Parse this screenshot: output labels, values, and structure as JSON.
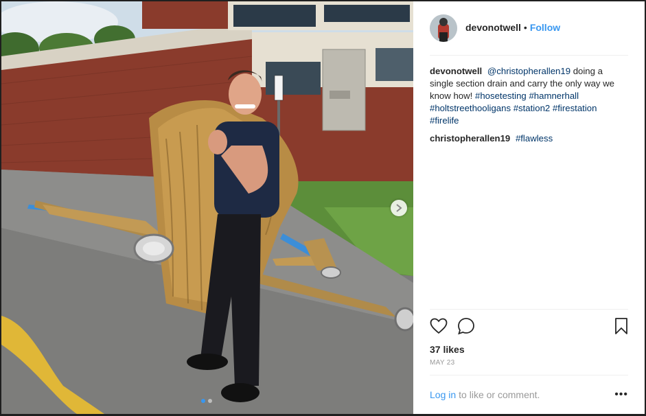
{
  "post": {
    "author": "devonotwell",
    "follow_label": "Follow",
    "separator": "•"
  },
  "comments": [
    {
      "user": "devonotwell",
      "mention": "@christopherallen19",
      "text": " doing a single section drain and carry the only way we know how! ",
      "hashtags": [
        "#hosetesting",
        "#hamnerhall",
        "#holtstreethooligans",
        "#station2",
        "#firestation",
        "#firelife"
      ]
    },
    {
      "user": "christopherallen19",
      "hashtags": [
        "#flawless"
      ]
    }
  ],
  "actions": {
    "like_icon": "heart-icon",
    "comment_icon": "comment-bubble-icon",
    "save_icon": "bookmark-icon"
  },
  "likes_text": "37 likes",
  "date_text": "MAY 23",
  "footer": {
    "login_label": "Log in",
    "rest_text": "to like or comment.",
    "more_label": "•••"
  },
  "carousel": {
    "next_icon": "chevron-right-icon",
    "slide_count": 2,
    "active_slide": 1
  },
  "colors": {
    "accent": "#3897f0",
    "link": "#003569",
    "muted": "#999999"
  }
}
